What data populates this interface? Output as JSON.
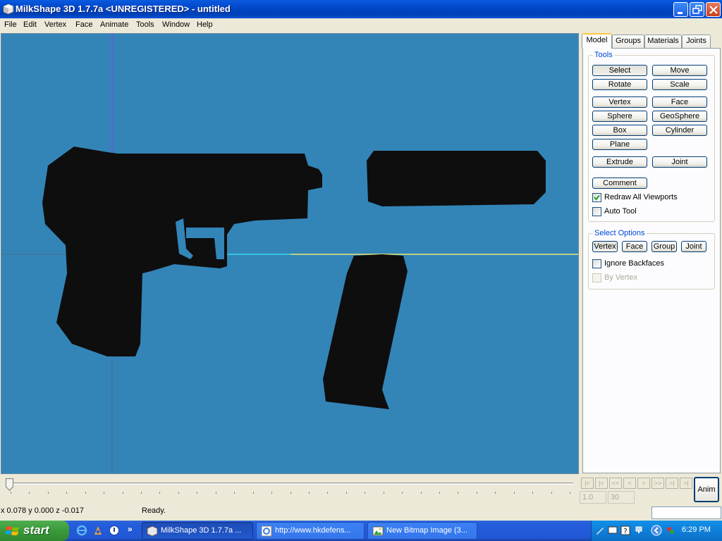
{
  "window": {
    "title": "MilkShape 3D 1.7.7a <UNREGISTERED> - untitled"
  },
  "menu": [
    "File",
    "Edit",
    "Vertex",
    "Face",
    "Animate",
    "Tools",
    "Window",
    "Help"
  ],
  "tabs": {
    "model": "Model",
    "groups": "Groups",
    "materials": "Materials",
    "joints": "Joints"
  },
  "tools": {
    "label": "Tools",
    "select": "Select",
    "move": "Move",
    "rotate": "Rotate",
    "scale": "Scale",
    "vertex": "Vertex",
    "face": "Face",
    "sphere": "Sphere",
    "geosphere": "GeoSphere",
    "box": "Box",
    "cylinder": "Cylinder",
    "plane": "Plane",
    "extrude": "Extrude",
    "joint": "Joint",
    "comment": "Comment",
    "redraw_all_viewports": "Redraw All Viewports",
    "redraw_checked": true,
    "auto_tool": "Auto Tool",
    "auto_tool_checked": false
  },
  "select_options": {
    "label": "Select Options",
    "vertex": "Vertex",
    "face": "Face",
    "group": "Group",
    "joint": "Joint",
    "ignore_backfaces": "Ignore Backfaces",
    "ignore_backfaces_checked": false,
    "by_vertex": "By Vertex",
    "by_vertex_checked": false
  },
  "timeline": {
    "nav": [
      "|<",
      "|<",
      "<<",
      "<",
      ">",
      ">>",
      ">|",
      ">|"
    ],
    "current_frame": "1.0",
    "total_frames": "30",
    "anim_label": "Anim",
    "slider_position": 0
  },
  "status": {
    "coords": "x 0.078 y 0.000 z -0.017",
    "message": "Ready."
  },
  "taskbar": {
    "start": "start",
    "tasks": [
      {
        "label": "MilkShape 3D 1.7.7a ...",
        "active": true
      },
      {
        "label": "http://www.hkdefens...",
        "active": false
      },
      {
        "label": "New Bitmap Image (3...",
        "active": false
      }
    ],
    "clock": "6:29 PM"
  },
  "colors": {
    "viewport_bg": "#3385B8",
    "model_fill": "#0E0E0E",
    "axis_x": "#F0F060",
    "axis_x_cyan": "#3AD8E8",
    "axis_y": "#7A50E0"
  }
}
